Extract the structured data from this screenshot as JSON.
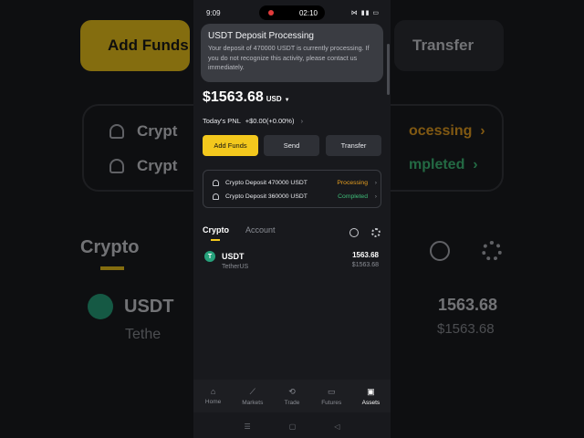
{
  "status_bar": {
    "time": "9:09",
    "recording_timer": "02:10",
    "indicators": "⋈ ▮▮ ▭"
  },
  "notification": {
    "title": "USDT Deposit Processing",
    "body": "Your deposit of 470000 USDT is currently processing. If you do not recognize this activity, please contact us immediately."
  },
  "balance": {
    "amount": "$1563.68",
    "currency": "USD"
  },
  "pnl": {
    "label": "Today's PNL",
    "value": "+$0.00(+0.00%)"
  },
  "actions": {
    "add_funds": "Add Funds",
    "send": "Send",
    "transfer": "Transfer"
  },
  "deposits": [
    {
      "label": "Crypto Deposit 470000 USDT",
      "status": "Processing"
    },
    {
      "label": "Crypto Deposit 360000 USDT",
      "status": "Completed"
    }
  ],
  "tabs": {
    "crypto": "Crypto",
    "account": "Account"
  },
  "asset": {
    "symbol": "USDT",
    "name": "TetherUS",
    "amount": "1563.68",
    "usd_value": "$1563.68",
    "icon_glyph": "T"
  },
  "nav": [
    {
      "label": "Home",
      "icon": "⌂"
    },
    {
      "label": "Markets",
      "icon": "⟋"
    },
    {
      "label": "Trade",
      "icon": "⟲"
    },
    {
      "label": "Futures",
      "icon": "▭"
    },
    {
      "label": "Assets",
      "icon": "▣"
    }
  ],
  "system_nav": {
    "menu": "☰",
    "home": "▢",
    "back": "◁"
  },
  "colors": {
    "accent": "#f3c81d",
    "processing": "#e8a020",
    "completed": "#3fbf7a",
    "tether": "#26a17b"
  }
}
